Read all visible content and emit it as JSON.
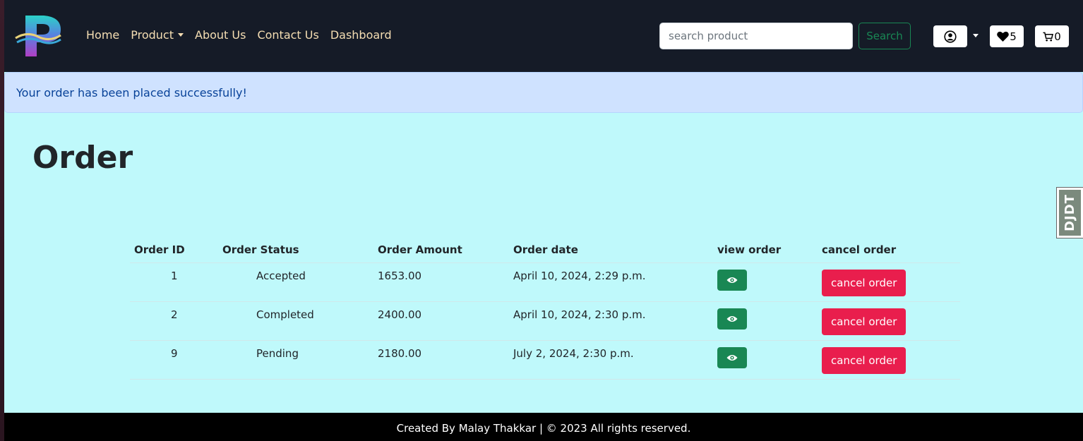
{
  "nav": {
    "links": [
      "Home",
      "Product",
      "About Us",
      "Contact Us",
      "Dashboard"
    ],
    "search_placeholder": "search product",
    "search_label": "Search",
    "wishlist_count": "5",
    "cart_count": "0"
  },
  "alert": {
    "message": "Your order has been placed successfully!"
  },
  "page": {
    "title": "Order"
  },
  "table": {
    "headers": [
      "Order ID",
      "Order Status",
      "Order Amount",
      "Order date",
      "view order",
      "cancel order"
    ],
    "rows": [
      {
        "id": "1",
        "status": "Accepted",
        "amount": "1653.00",
        "date": "April 10, 2024, 2:29 p.m.",
        "cancel_label": "cancel order"
      },
      {
        "id": "2",
        "status": "Completed",
        "amount": "2400.00",
        "date": "April 10, 2024, 2:30 p.m.",
        "cancel_label": "cancel order"
      },
      {
        "id": "9",
        "status": "Pending",
        "amount": "2180.00",
        "date": "July 2, 2024, 2:30 p.m.",
        "cancel_label": "cancel order"
      }
    ]
  },
  "debug_toolbar": {
    "label": "DJDT"
  },
  "footer": {
    "text": "Created By Malay Thakkar | © 2023 All rights reserved."
  },
  "colors": {
    "navbar_bg": "#151b27",
    "page_bg": "#bff9fb",
    "alert_bg": "#cfe2ff",
    "success": "#198754",
    "danger": "#e91e4d",
    "footer_bg": "#000000"
  },
  "icons": {
    "logo": "letter-p-logo",
    "user": "user-circle-icon",
    "wishlist": "heart-icon",
    "cart": "cart-icon",
    "view": "eye-icon"
  }
}
